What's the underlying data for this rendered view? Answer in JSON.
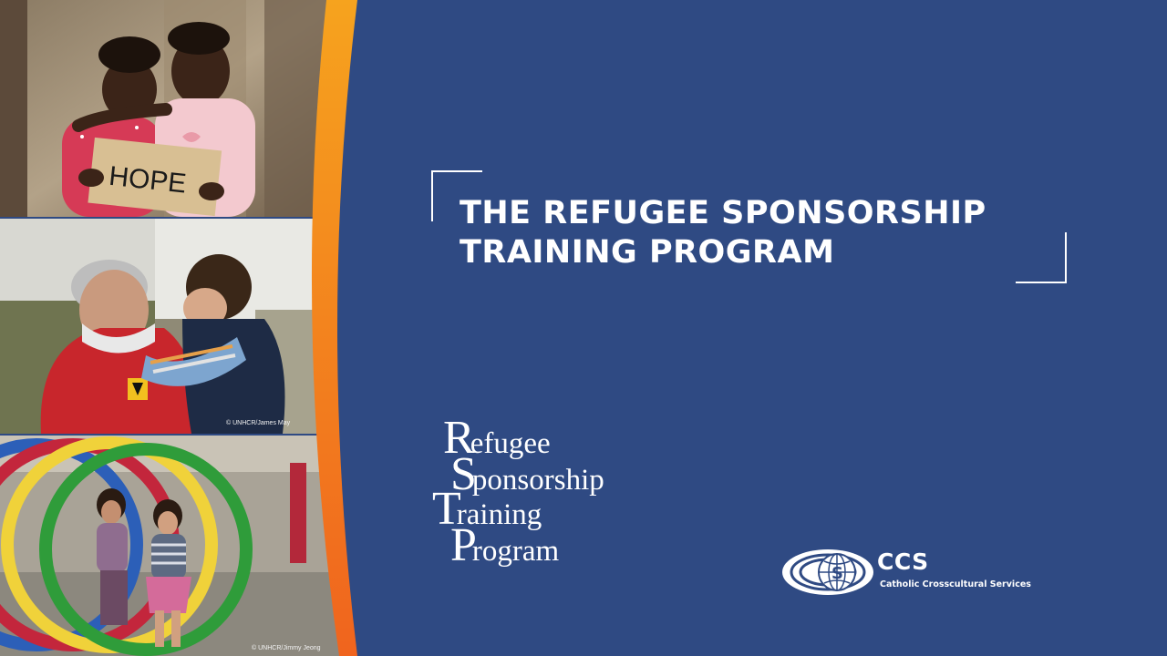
{
  "slide": {
    "title_line_1": "THE REFUGEE SPONSORSHIP",
    "title_line_2": "TRAINING PROGRAM",
    "background_color": "#2f4a83",
    "accent_gradient": [
      "#f6a31e",
      "#f0641e"
    ]
  },
  "photos": {
    "photo_1": {
      "sign_text": "HOPE"
    },
    "photo_2": {
      "credit": "© UNHCR/James May"
    },
    "photo_3": {
      "credit": "© UNHCR/Jimmy Jeong"
    }
  },
  "rstp_logo": {
    "line_1_initial": "R",
    "line_1_rest": "efugee",
    "line_2_initial": "S",
    "line_2_rest": "ponsorship",
    "line_3_initial": "T",
    "line_3_rest": "raining",
    "line_4_initial": "P",
    "line_4_rest": "rogram"
  },
  "ccs_logo": {
    "emblem_icon": "globe-c-emblem",
    "abbreviation": "CCS",
    "name": "Catholic Crosscultural Services"
  }
}
